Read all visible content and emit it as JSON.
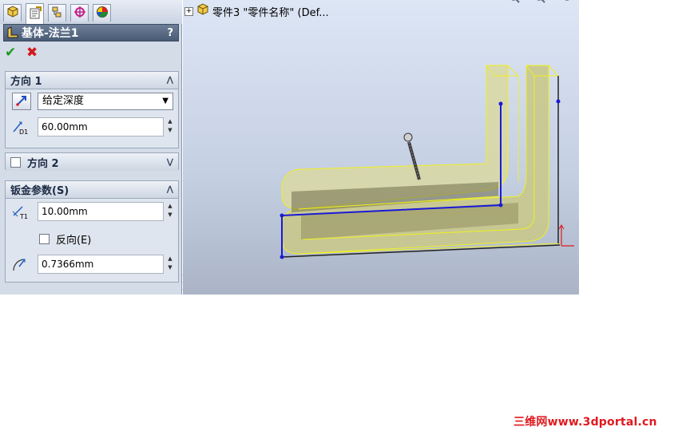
{
  "feature_manager_tabs": [
    {
      "icon": "featuremanager-tree-icon"
    },
    {
      "icon": "propertymanager-icon"
    },
    {
      "icon": "configurationmanager-icon"
    },
    {
      "icon": "dimxpertmanager-icon"
    },
    {
      "icon": "displaymanager-icon"
    }
  ],
  "panel": {
    "title": "基体-法兰1",
    "help": "?",
    "ok_symbol": "✔",
    "cancel_symbol": "✖"
  },
  "direction1": {
    "title": "方向 1",
    "end_condition": "给定深度",
    "depth": "60.00mm"
  },
  "direction2": {
    "title": "方向 2",
    "checked": false
  },
  "sheetmetal": {
    "title": "钣金参数(S)",
    "thickness": "10.00mm",
    "reverse_label": "反向(E)",
    "reverse_checked": false,
    "bend_radius": "0.7366mm"
  },
  "viewport": {
    "tree_text": "零件3 \"零件名称\" (Def..."
  },
  "colors": {
    "panel_bg": "#d4dce8",
    "title_bar": "#485a74",
    "model_fill": "#d6d6a0",
    "model_edge": "#f0f020",
    "sketch_line": "#1a1ad6",
    "watermark": "#e0191f"
  },
  "watermark": "三维网www.3dportal.cn"
}
